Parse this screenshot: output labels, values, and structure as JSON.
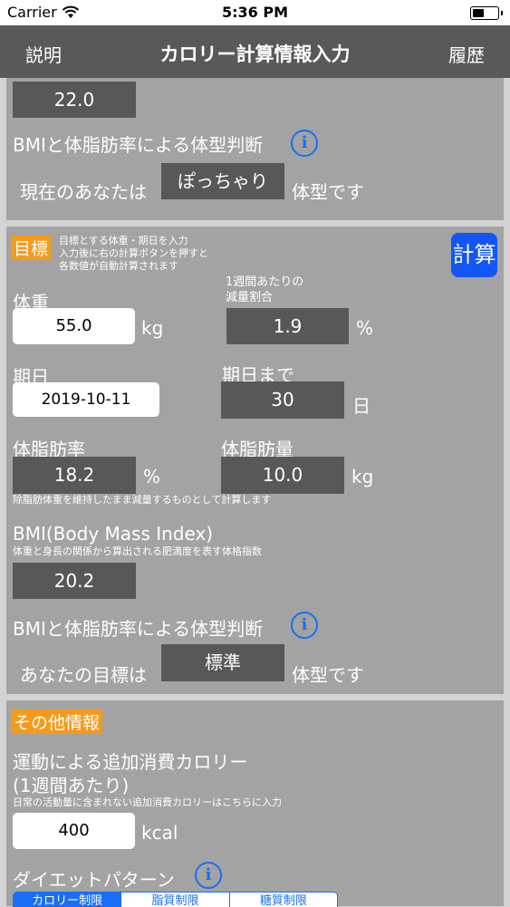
{
  "status_bar": {
    "carrier": "Carrier",
    "time": "5:36 PM"
  },
  "nav": {
    "left_button": "説明",
    "title": "カロリー計算情報入力",
    "right_button": "履歴"
  },
  "current": {
    "bmi_value": "22.0",
    "judge_label": "BMIと体脂肪率による体型判断",
    "prefix": "現在のあなたは",
    "type_value": "ぽっちゃり",
    "suffix": "体型です"
  },
  "goal": {
    "section_label": "目標",
    "hint_lines": [
      "目標とする体重・期日を入力",
      "入力後に右の計算ボタンを押すと",
      "各数値が自動計算されます"
    ],
    "calc_button": "計算",
    "weight_label": "体重",
    "weight_value": "55.0",
    "weight_unit": "kg",
    "rate_label_line1": "1週間あたりの",
    "rate_label_line2": "減量割合",
    "rate_value": "1.9",
    "rate_unit": "%",
    "date_label": "期日",
    "date_value": "2019-10-11",
    "days_label": "期日まで",
    "days_value": "30",
    "days_unit": "日",
    "fat_rate_label": "体脂肪率",
    "fat_rate_value": "18.2",
    "fat_rate_unit": "%",
    "fat_mass_label": "体脂肪量",
    "fat_mass_value": "10.0",
    "fat_mass_unit": "kg",
    "fat_note": "除脂肪体重を維持したまま減量するものとして計算します",
    "bmi_title": "BMI(Body Mass Index)",
    "bmi_note": "体重と身長の関係から算出される肥満度を表す体格指数",
    "bmi_value": "20.2",
    "judge_label": "BMIと体脂肪率による体型判断",
    "prefix": "あなたの目標は",
    "type_value": "標準",
    "suffix": "体型です"
  },
  "other": {
    "section_label": "その他情報",
    "exercise_label_line1": "運動による追加消費カロリー",
    "exercise_label_line2": "(1週間あたり)",
    "exercise_note": "日常の活動量に含まれない追加消費カロリーはこちらに入力",
    "exercise_value": "400",
    "exercise_unit": "kcal",
    "diet_label": "ダイエットパターン",
    "diet_options": [
      "カロリー制限",
      "脂質制限",
      "糖質制限"
    ]
  },
  "colors": {
    "nav": "#595959",
    "panel": "#a3a3a3",
    "accent_blue": "#1a6ef5",
    "orange": "#f59a1b"
  }
}
